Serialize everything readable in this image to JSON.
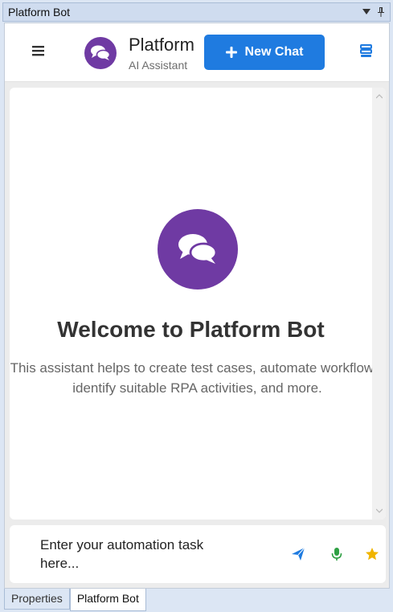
{
  "panel": {
    "title": "Platform Bot",
    "dropdown_icon": "triangle-down-icon",
    "pin_icon": "pin-icon"
  },
  "header": {
    "menu_icon": "hamburger-menu-icon",
    "brand_title": "Platform",
    "brand_subtitle": "AI Assistant",
    "new_chat_label": "New Chat",
    "new_chat_icon": "plus-icon",
    "stack_icon": "server-stack-icon"
  },
  "welcome": {
    "title": "Welcome to Platform Bot",
    "description": "This assistant helps to create test cases, automate workflows, identify suitable RPA activities, and more."
  },
  "input": {
    "placeholder": "Enter your automation task here...",
    "send_icon": "paper-plane-icon",
    "mic_icon": "microphone-icon",
    "star_icon": "star-icon"
  },
  "tabs": [
    {
      "label": "Properties",
      "active": false
    },
    {
      "label": "Platform Bot",
      "active": true
    }
  ],
  "colors": {
    "accent": "#1f7be0",
    "brand": "#6f3aa3",
    "mic": "#2ea043",
    "star": "#f0b400"
  }
}
